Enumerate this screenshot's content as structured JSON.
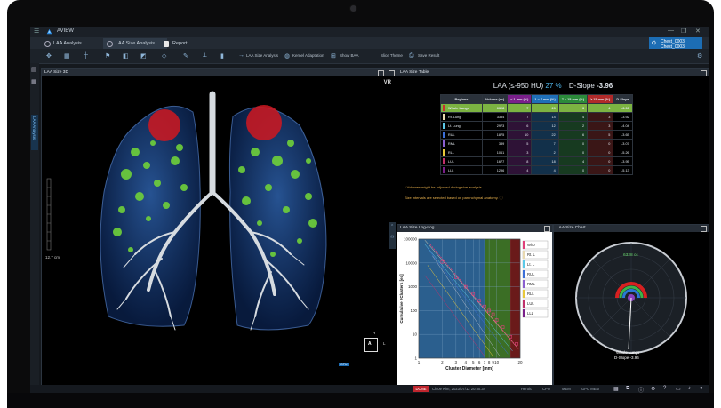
{
  "app": {
    "title": "AVIEW",
    "window_controls": [
      "—",
      "❐",
      "✕"
    ]
  },
  "tabs": [
    {
      "label": "LAA Analysis",
      "active": false
    },
    {
      "label": "LAA Size Analysis",
      "active": true
    },
    {
      "label": "Report",
      "active": false
    }
  ],
  "patient": {
    "line1": "Chest_0003",
    "line2": "Chest_0003"
  },
  "toolbar": {
    "labels": [
      "LAA Size Analysis",
      "Kernel Adaptation",
      "Show BAA",
      "Slice Theme",
      "Save Result"
    ]
  },
  "sidebar": {
    "vertical_tab": "LAA Analysis"
  },
  "panel_3d": {
    "title": "LAA Size 3D",
    "vr_label": "VR",
    "scale_label": "12.7 cm",
    "orient_h": "H",
    "orient_a": "A",
    "orient_l": "L",
    "gpu_badge": "GPU"
  },
  "panel_table": {
    "title": "LAA Size Table",
    "headline_prefix": "LAA (≤-950 HU)",
    "headline_pct": "27 %",
    "headline_dslope_label": "D-Slope",
    "headline_dslope_value": "-3.96",
    "columns": [
      "Regions",
      "Volume (cc)",
      "< 1 mm (%)",
      "1 ~ 7 mm (%)",
      "7 ~ 15 mm (%)",
      "≥ 15 mm (%)",
      "D-Slope"
    ],
    "column_colors": [
      "#2a313a",
      "#2a313a",
      "#7a1f8a",
      "#1f6fb8",
      "#2b8a3a",
      "#b02a2a",
      "#2a313a"
    ],
    "rows": [
      {
        "region": "Whole Lungs",
        "volume": "6328",
        "c1": "7",
        "c2": "23",
        "c3": "3",
        "c4": "4",
        "dslope": "-3.96",
        "color": "#c9302c"
      },
      {
        "region": "Rt. Lung",
        "volume": "3354",
        "c1": "7",
        "c2": "14",
        "c3": "4",
        "c4": "3",
        "dslope": "-3.92",
        "color": "#e8d8b0"
      },
      {
        "region": "Lt. Lung",
        "volume": "2973",
        "c1": "6",
        "c2": "12",
        "c3": "2",
        "c4": "3",
        "dslope": "-4.04",
        "color": "#5ac8e8"
      },
      {
        "region": "RUL",
        "volume": "1875",
        "c1": "10",
        "c2": "22",
        "c3": "6",
        "c4": "5",
        "dslope": "-3.65",
        "color": "#3b6fd8"
      },
      {
        "region": "RML",
        "volume": "389",
        "c1": "5",
        "c2": "7",
        "c3": "0",
        "c4": "0",
        "dslope": "-3.07",
        "color": "#8a5fd0"
      },
      {
        "region": "RLL",
        "volume": "1061",
        "c1": "3",
        "c2": "2",
        "c3": "0",
        "c4": "0",
        "dslope": "-5.26",
        "color": "#e8c83a"
      },
      {
        "region": "LUL",
        "volume": "1677",
        "c1": "8",
        "c2": "18",
        "c3": "4",
        "c4": "0",
        "dslope": "-3.95",
        "color": "#c0306a"
      },
      {
        "region": "LLL",
        "volume": "1296",
        "c1": "4",
        "c2": "4",
        "c3": "0",
        "c4": "0",
        "dslope": "-5.13",
        "color": "#7a1f8a"
      }
    ],
    "note1": "* Volumes might be adjusted during size analysis.",
    "note2": "Size intervals are selected based on parenchymal anatomy."
  },
  "panel_loglog": {
    "title": "LAA Size Log-Log",
    "legend": [
      {
        "label": "Who",
        "color": "#e0407a"
      },
      {
        "label": "Rt. L",
        "color": "#e8d8b0"
      },
      {
        "label": "Lt. L",
        "color": "#5ac8e8"
      },
      {
        "label": "RUL",
        "color": "#3b6fd8"
      },
      {
        "label": "RML",
        "color": "#8a5fd0"
      },
      {
        "label": "RLL",
        "color": "#e8c83a"
      },
      {
        "label": "LUL",
        "color": "#c0306a"
      },
      {
        "label": "LLL",
        "color": "#7a1f8a"
      }
    ]
  },
  "chart_data": {
    "type": "scatter",
    "title": "",
    "xlabel": "Cluster Diameter [mm]",
    "ylabel": "Cumulative #Clusters [ea]",
    "x_scale": "log",
    "y_scale": "log",
    "xlim": [
      1,
      20
    ],
    "ylim": [
      1,
      100000
    ],
    "x_ticks": [
      "1",
      "2",
      "3",
      "4",
      "5",
      "6",
      "7",
      "8",
      "9",
      "10",
      "20"
    ],
    "y_ticks": [
      "1",
      "10",
      "100",
      "1000",
      "10000",
      "100000"
    ],
    "bands": [
      {
        "from": 1,
        "to": 7,
        "color": "#2b5f8e"
      },
      {
        "from": 7,
        "to": 15,
        "color": "#3b6e25"
      },
      {
        "from": 15,
        "to": 20,
        "color": "#6a1a1a"
      }
    ],
    "series": [
      {
        "name": "Who",
        "color": "#e0407a",
        "x": [
          2,
          3,
          4,
          5,
          6,
          7,
          8,
          9,
          10,
          12,
          15,
          18
        ],
        "y": [
          11000,
          2500,
          1000,
          500,
          260,
          150,
          100,
          70,
          40,
          20,
          8,
          4
        ]
      }
    ]
  },
  "panel_sizechart": {
    "title": "LAA Size Chart",
    "volume_label": "6328 cc",
    "caption_line1": "Whole Lungs",
    "caption_line2": "D-Slope -3.96"
  },
  "statusbar": {
    "done": "DONE",
    "user": "Chloe Kim, 2023/07/12 20:50:34",
    "ram": "Heroic",
    "cpu": "CPU",
    "mem": "MEM",
    "gpu": "GPU MEM"
  }
}
